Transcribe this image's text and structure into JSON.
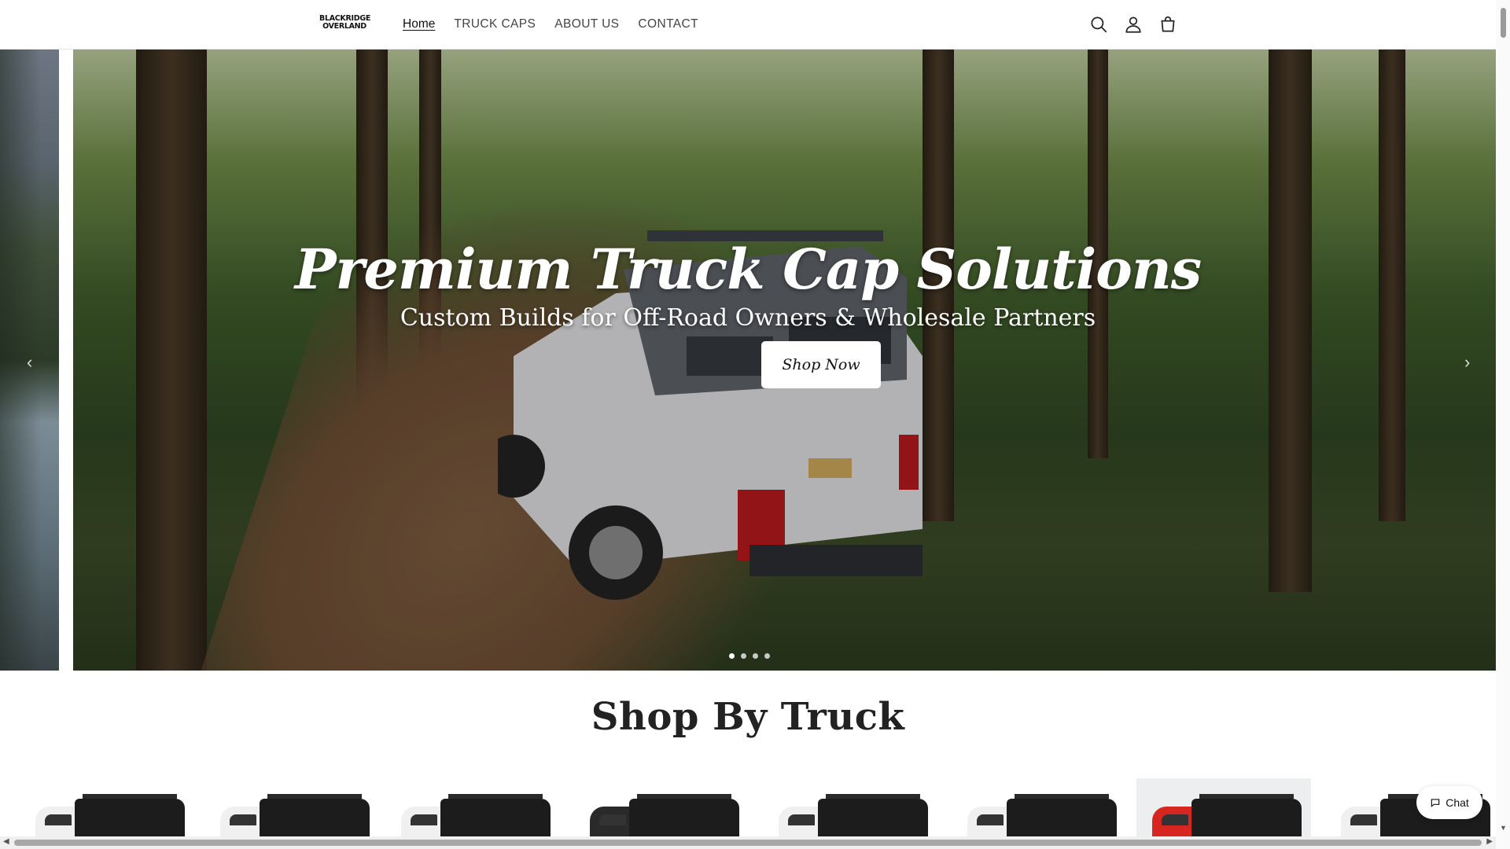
{
  "header": {
    "logo_line1": "BLACKRIDGE",
    "logo_line2": "OVERLAND",
    "nav": [
      {
        "label": "Home",
        "active": true
      },
      {
        "label": "TRUCK CAPS"
      },
      {
        "label": "ABOUT US"
      },
      {
        "label": "CONTACT"
      }
    ],
    "icons": [
      "search-icon",
      "account-icon",
      "cart-icon"
    ]
  },
  "hero": {
    "title": "Premium Truck Cap Solutions",
    "subtitle": "Custom Builds for Off-Road Owners & Wholesale Partners",
    "button": "Shop Now",
    "slide_count": 4,
    "active_slide": 1,
    "prev_arrow": "‹",
    "next_arrow": "›"
  },
  "section": {
    "title": "Shop By Truck",
    "card_count": 8
  },
  "chat": {
    "label": "Chat"
  },
  "colors": {
    "accent": "#111111",
    "background": "#ffffff"
  }
}
